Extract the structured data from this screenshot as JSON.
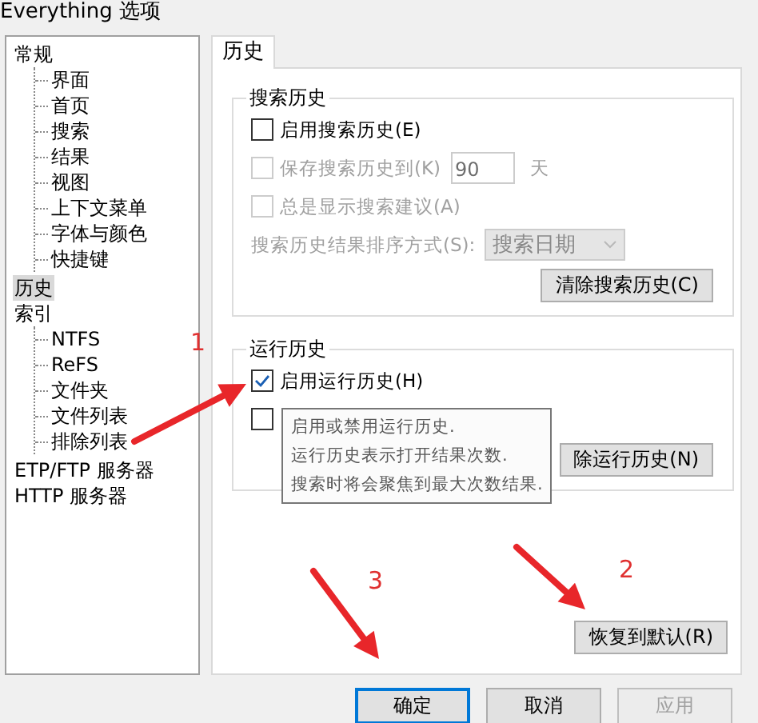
{
  "window": {
    "title": "Everything 选项"
  },
  "tree": [
    {
      "label": "常规",
      "selected": false,
      "children": [
        {
          "label": "界面",
          "selected": false
        },
        {
          "label": "首页",
          "selected": false
        },
        {
          "label": "搜索",
          "selected": false
        },
        {
          "label": "结果",
          "selected": false
        },
        {
          "label": "视图",
          "selected": false
        },
        {
          "label": "上下文菜单",
          "selected": false
        },
        {
          "label": "字体与颜色",
          "selected": false
        },
        {
          "label": "快捷键",
          "selected": false
        }
      ]
    },
    {
      "label": "历史",
      "selected": true
    },
    {
      "label": "索引",
      "selected": false,
      "children": [
        {
          "label": "NTFS",
          "selected": false
        },
        {
          "label": "ReFS",
          "selected": false
        },
        {
          "label": "文件夹",
          "selected": false
        },
        {
          "label": "文件列表",
          "selected": false
        },
        {
          "label": "排除列表",
          "selected": false
        }
      ]
    },
    {
      "label": "ETP/FTP 服务器",
      "selected": false
    },
    {
      "label": "HTTP 服务器",
      "selected": false
    }
  ],
  "tabs": [
    {
      "label": "历史",
      "selected": true
    }
  ],
  "search_history": {
    "title": "搜索历史",
    "enable": {
      "label": "启用搜索历史(E)",
      "checked": false,
      "disabled": false
    },
    "save": {
      "label": "保存搜索历史到(K)",
      "checked": false,
      "disabled": true,
      "value": "90",
      "unit": "天"
    },
    "suggest": {
      "label": "总是显示搜索建议(A)",
      "checked": false,
      "disabled": true
    },
    "sort": {
      "label": "搜索历史结果排序方式(S):",
      "value": "搜索日期",
      "disabled": true
    },
    "clear_button": "清除搜索历史(C)"
  },
  "run_history": {
    "title": "运行历史",
    "enable": {
      "label": "启用运行历史(H)",
      "checked": true,
      "disabled": false
    },
    "save": {
      "checked": false,
      "disabled": false
    },
    "clear_button": "除运行历史(N)"
  },
  "tooltip": {
    "lines": [
      "启用或禁用运行历史.",
      "运行历史表示打开结果次数.",
      "搜索时将会聚焦到最大次数结果."
    ]
  },
  "restore_button": "恢复到默认(R)",
  "buttons": [
    {
      "label": "确定",
      "default": true,
      "disabled": false
    },
    {
      "label": "取消",
      "default": false,
      "disabled": false
    },
    {
      "label": "应用",
      "default": false,
      "disabled": true
    }
  ],
  "annotations": [
    {
      "label": "1"
    },
    {
      "label": "2"
    },
    {
      "label": "3"
    }
  ]
}
